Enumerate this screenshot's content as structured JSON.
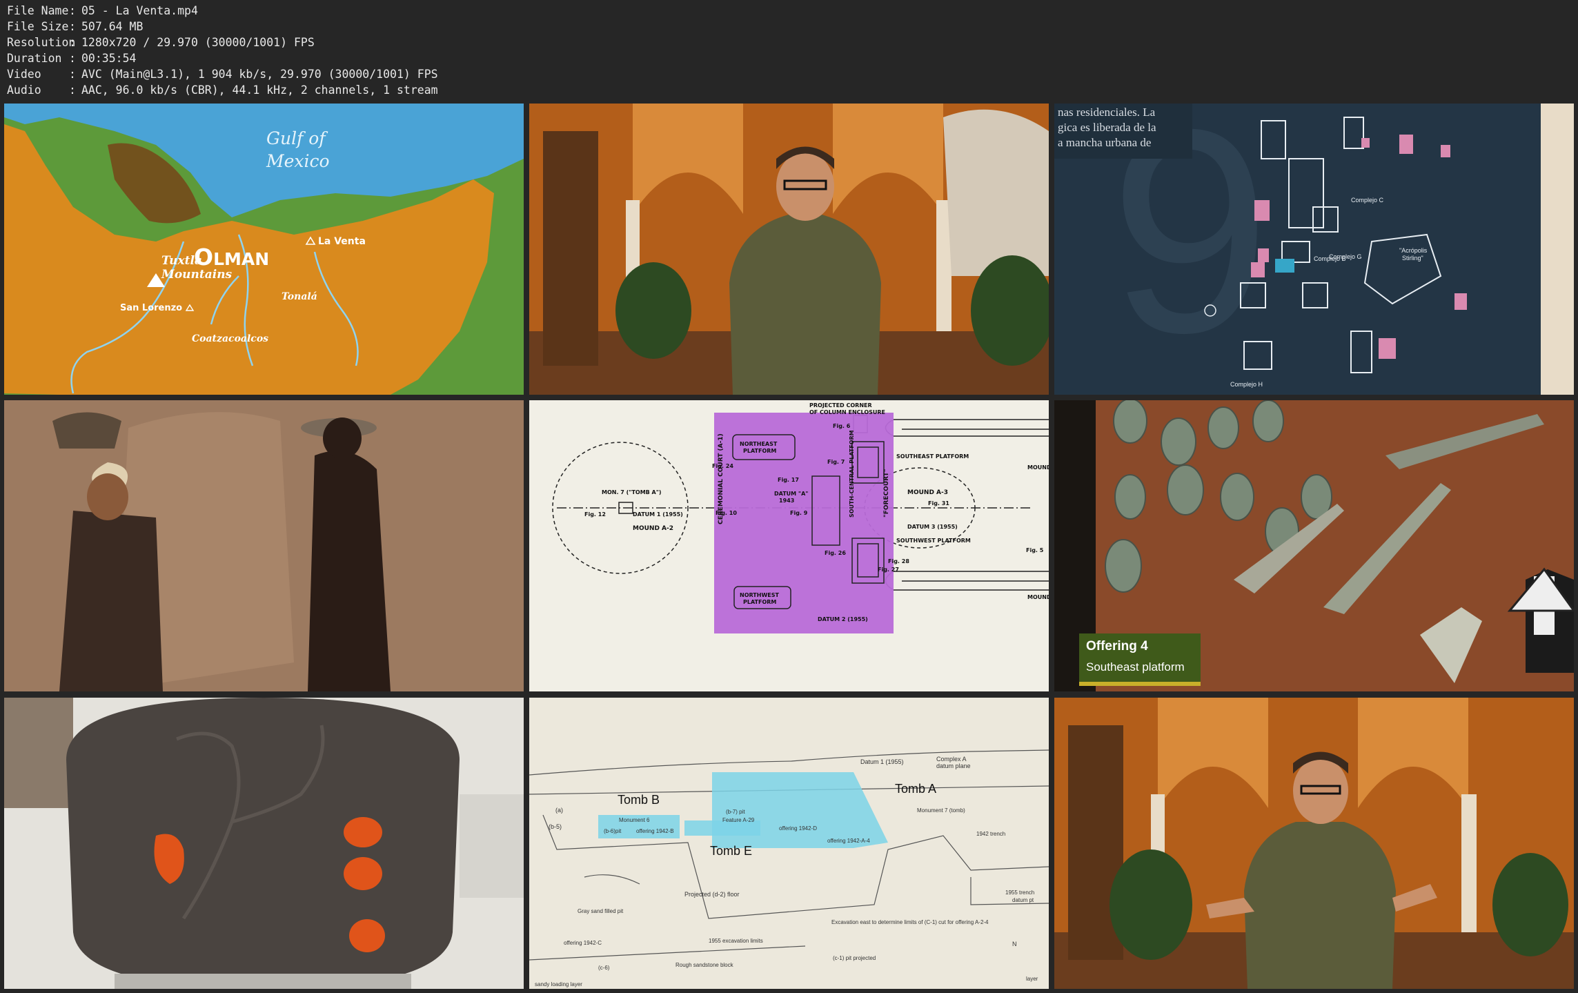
{
  "file_info": [
    {
      "label": "File Name",
      "value": "05 - La Venta.mp4"
    },
    {
      "label": "File Size",
      "value": "507.64 MB"
    },
    {
      "label": "Resolution",
      "value": "1280x720 / 29.970 (30000/1001) FPS"
    },
    {
      "label": "Duration",
      "value": "00:35:54"
    },
    {
      "label": "Video",
      "value": "AVC (Main@L3.1), 1 904 kb/s, 29.970 (30000/1001) FPS"
    },
    {
      "label": "Audio",
      "value": "AAC, 96.0 kb/s (CBR), 44.1 kHz, 2 channels, 1 stream"
    }
  ],
  "separator": ":",
  "thumbnails": {
    "map": {
      "gulf_line1": "Gulf of",
      "gulf_line2": "Mexico",
      "tuxtla_line1": "Tuxtla",
      "tuxtla_line2": "Mountains",
      "region_first": "O",
      "region_rest": "LMAN",
      "la_venta": "La Venta",
      "san_lorenzo": "San Lorenzo",
      "tonala": "Tonalá",
      "coatzacoalcos": "Coatzacoalcos"
    },
    "museum": {
      "text_line1": "nas residenciales. La",
      "text_line2": "gica es liberada de la",
      "text_line3": "a mancha urbana de",
      "complejo_g": "Complejo G",
      "complejo_c": "Complejo C",
      "complejo_b": "Complejo B",
      "acropolis_line1": "\"Acrópolis",
      "acropolis_line2": "Stirling\"",
      "complejo_h": "Complejo H"
    },
    "plan": {
      "projected_line1": "PROJECTED CORNER",
      "projected_line2": "OF COLUMN ENCLOSURE",
      "fig6": "Fig. 6",
      "northeast_line1": "NORTHEAST",
      "northeast_line2": "PLATFORM",
      "southeast_platform": "SOUTHEAST PLATFORM",
      "mound_right_top": "MOUND",
      "fig24": "Fig. 24",
      "fig7": "Fig. 7",
      "fig17": "Fig. 17",
      "ceremonial_court": "CEREMONIAL COURT (A-1)",
      "datum_a_line1": "DATUM \"A\"",
      "datum_a_line2": "1943",
      "south_central": "SOUTH-CENTRAL PLATFORM",
      "forecourt": "\"FORECOURT\"",
      "mound_a3": "MOUND A-3",
      "fig31": "Fig. 31",
      "datum3": "DATUM 3 (1955)",
      "mon7": "MON. 7 (\"TOMB A\")",
      "fig12": "Fig. 12",
      "datum1": "DATUM 1 (1955)",
      "fig10": "Fig. 10",
      "fig9": "Fig. 9",
      "mound_a2": "MOUND A-2",
      "southwest_platform": "SOUTHWEST PLATFORM",
      "fig26": "Fig. 26",
      "fig28": "Fig. 28",
      "fig27": "Fig. 27",
      "fig5": "Fig. 5",
      "northwest_line1": "NORTHWEST",
      "northwest_line2": "PLATFORM",
      "datum2": "DATUM 2 (1955)",
      "mound_right_bottom": "MOUND"
    },
    "offering": {
      "caption_title": "Offering 4",
      "caption_subtitle": "Southeast platform"
    },
    "section": {
      "datum1": "Datum 1 (1955)",
      "complex_a_line1": "Complex A",
      "complex_a_line2": "datum plane",
      "tomb_b": "Tomb B",
      "tomb_a": "Tomb A",
      "tomb_e": "Tomb E",
      "monument6": "Monument 6",
      "monument7": "Monument 7 (tomb)",
      "a": "(a)",
      "b5": "(b-5)",
      "b6pit": "(b-6)pit",
      "offering_1942b": "offering 1942-B",
      "b7pit": "(b-7) pit",
      "feature_a29": "Feature A-29",
      "offering_1942d": "offering 1942-D",
      "offering_1942a4": "offering 1942-A-4",
      "trench_1942": "1942 trench",
      "projected_floor": "Projected (d-2) floor",
      "gray_sand": "Gray sand filled pit",
      "offering_1942c": "offering 1942-C",
      "excavation_1955": "1955 excavation limits",
      "c6": "(c-6)",
      "sandy_loading": "sandy loading layer",
      "rough_sandstone": "Rough sandstone block",
      "excavation_east": "Excavation east to determine limits of (C-1) cut for offering A-2-4",
      "c1pit": "(c-1) pit projected",
      "trench_1955": "1955 trench",
      "datum_pt": "datum pt",
      "n": "N",
      "layer": "layer"
    }
  },
  "colors": {
    "background": "#262626",
    "metadata_text": "#e8e8e8",
    "map_ocean": "#4aa3d6",
    "map_land": "#d98a1e",
    "map_green": "#5d9a3a",
    "court_highlight": "#b86ad8",
    "tomb_highlight": "#7dd3e8",
    "caption_green": "#3f5a1a",
    "caption_accent": "#c9b02a"
  }
}
